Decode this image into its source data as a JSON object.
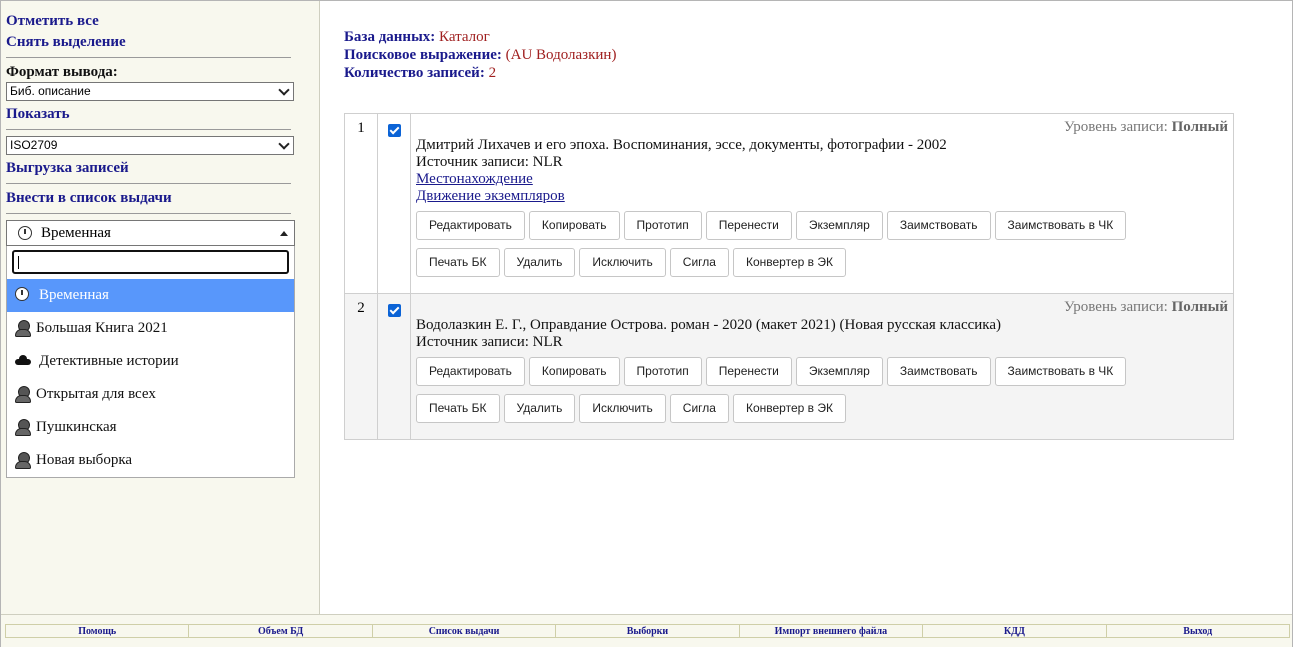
{
  "sidebar": {
    "select_all": "Отметить все",
    "deselect": "Снять выделение",
    "output_format_label": "Формат вывода:",
    "output_format_value": "Биб. описание",
    "show_link": "Показать",
    "show_value": "ISO2709",
    "export_link": "Выгрузка записей",
    "issue_list_link": "Внести в список выдачи",
    "dropdown": {
      "selected": "Временная",
      "search_value": "",
      "options": [
        {
          "label": "Временная",
          "icon": "clock-icon",
          "selected": true
        },
        {
          "label": "Большая Книга 2021",
          "icon": "person-icon"
        },
        {
          "label": "Детективные истории",
          "icon": "cloud-icon"
        },
        {
          "label": "Открытая для всех",
          "icon": "person-icon"
        },
        {
          "label": "Пушкинская",
          "icon": "person-icon"
        },
        {
          "label": "Новая выборка",
          "icon": "person-icon"
        }
      ]
    }
  },
  "search_info": {
    "db_label": "База данных:",
    "db_value": "Каталог",
    "query_label": "Поисковое выражение:",
    "query_value": "(AU Водолазкин)",
    "count_label": "Количество записей:",
    "count_value": "2"
  },
  "records": [
    {
      "num": "1",
      "level_label": "Уровень записи:",
      "level_value": "Полный",
      "title": "Дмитрий Лихачев и его эпоха. Воспоминания, эссе, документы, фотографии - 2002",
      "source": "Источник записи: NLR",
      "links": [
        "Местонахождение",
        "Движение экземпляров"
      ]
    },
    {
      "num": "2",
      "level_label": "Уровень записи:",
      "level_value": "Полный",
      "title": "Водолазкин Е. Г., Оправдание Острова. роман - 2020 (макет 2021) (Новая русская классика)",
      "source": "Источник записи: NLR",
      "links": []
    }
  ],
  "buttons_row1": [
    "Редактировать",
    "Копировать",
    "Прототип",
    "Перенести",
    "Экземпляр",
    "Заимствовать",
    "Заимствовать в ЧК"
  ],
  "buttons_row2": [
    "Печать БК",
    "Удалить",
    "Исключить",
    "Сигла",
    "Конвертер в ЭК"
  ],
  "footer": [
    "Помощь",
    "Объем БД",
    "Список выдачи",
    "Выборки",
    "Импорт внешнего файла",
    "КДД",
    "Выход"
  ]
}
